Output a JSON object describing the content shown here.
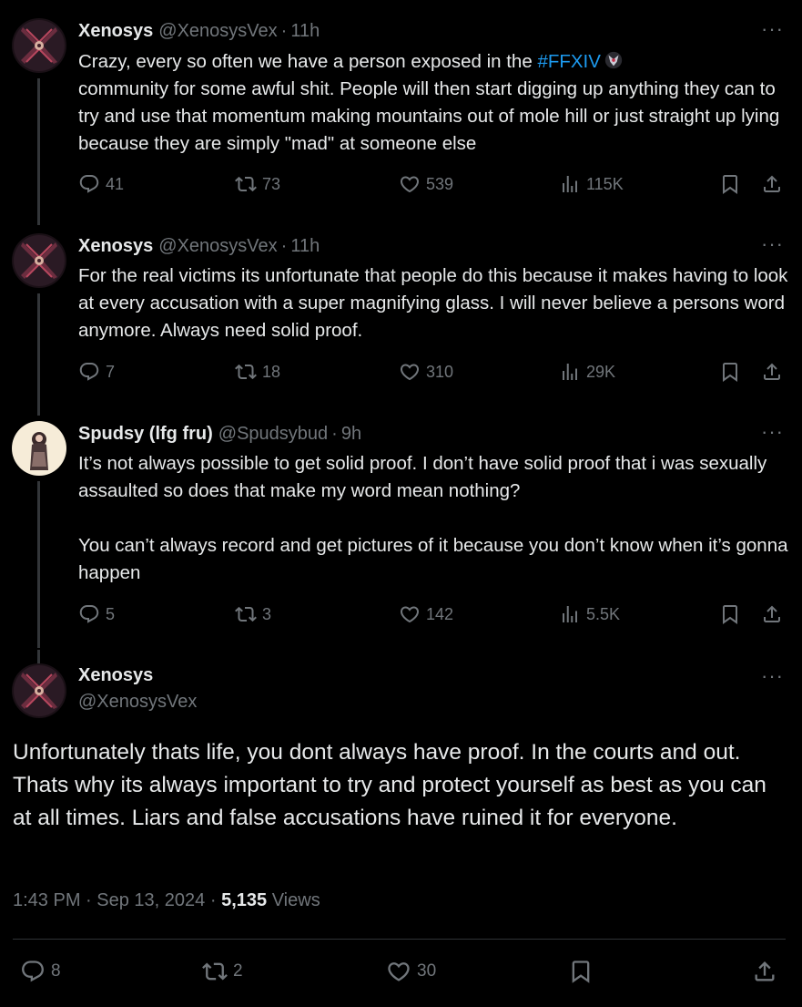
{
  "thread": [
    {
      "name": "Xenosys",
      "handle": "@XenosysVex",
      "time": "11h",
      "text_before_hashtag": "Crazy, every so often we have a person exposed in the ",
      "hashtag": "#FFXIV",
      "text_after_hashtag": "\ncommunity for some awful shit. People will then start digging up anything they can to try and use that momentum making mountains out of mole hill or just straight up lying because they are simply \"mad\" at someone else",
      "replies": "41",
      "reposts": "73",
      "likes": "539",
      "views": "115K"
    },
    {
      "name": "Xenosys",
      "handle": "@XenosysVex",
      "time": "11h",
      "text": "For the real victims its unfortunate that people do this because it makes having to look at every accusation with a super magnifying glass. I will never believe a persons word anymore. Always need solid proof.",
      "replies": "7",
      "reposts": "18",
      "likes": "310",
      "views": "29K"
    },
    {
      "name": "Spudsy (lfg fru)",
      "handle": "@Spudsybud",
      "time": "9h",
      "text": "It’s not always possible to get solid proof. I don’t have solid proof that i was sexually assaulted so does that make my word mean nothing?\n\nYou can’t always record and get pictures of it because you don’t know when it’s gonna happen",
      "replies": "5",
      "reposts": "3",
      "likes": "142",
      "views": "5.5K"
    }
  ],
  "main": {
    "name": "Xenosys",
    "handle": "@XenosysVex",
    "text": "Unfortunately thats life, you dont always have proof. In the courts and out. Thats why its always important to try and protect yourself as best as you can at all times. Liars and false accusations have ruined it for everyone.",
    "time": "1:43 PM",
    "date": "Sep 13, 2024",
    "views_count": "5,135",
    "views_label": "Views",
    "replies": "8",
    "reposts": "2",
    "likes": "30"
  },
  "ui": {
    "more_glyph": "···",
    "sep": "·"
  },
  "icons": [
    "reply-icon",
    "repost-icon",
    "like-icon",
    "views-icon",
    "bookmark-icon",
    "share-icon",
    "more-icon"
  ],
  "colors": {
    "background": "#000000",
    "text": "#e7e9ea",
    "muted": "#71767b",
    "link": "#1d9bf0",
    "divider": "#2f3336"
  }
}
